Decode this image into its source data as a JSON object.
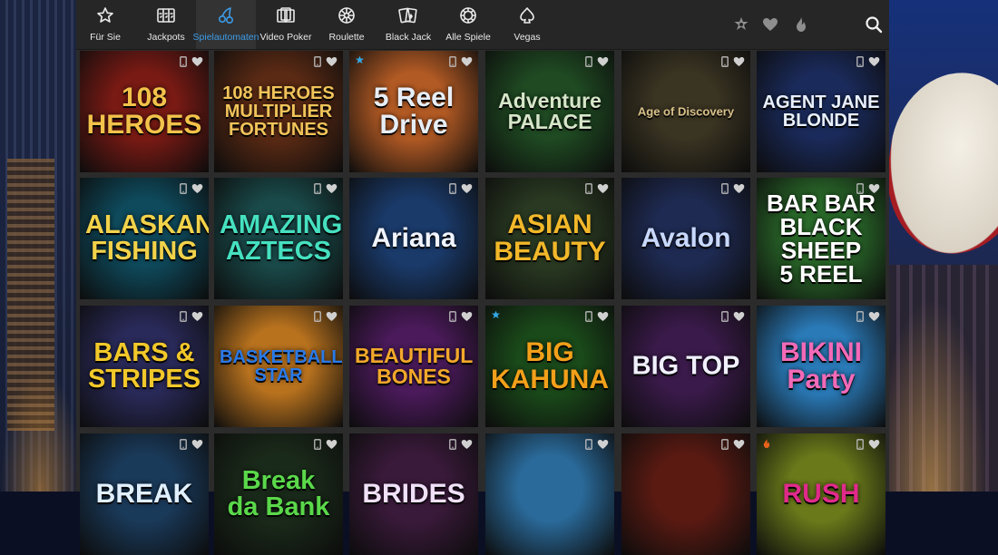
{
  "nav": {
    "items": [
      {
        "label": "Für Sie",
        "icon": "star-icon",
        "active": false
      },
      {
        "label": "Jackpots",
        "icon": "slot-reels-icon",
        "active": false
      },
      {
        "label": "Spielautomaten",
        "icon": "cherries-icon",
        "active": true
      },
      {
        "label": "Video Poker",
        "icon": "cards-icon",
        "active": false
      },
      {
        "label": "Roulette",
        "icon": "roulette-wheel-icon",
        "active": false
      },
      {
        "label": "Black Jack",
        "icon": "blackjack-cards-icon",
        "active": false
      },
      {
        "label": "Alle Spiele",
        "icon": "chip-icon",
        "active": false
      },
      {
        "label": "Vegas",
        "icon": "spade-icon",
        "active": false
      }
    ],
    "right_icons": [
      "sheriff-star-icon",
      "heart-icon",
      "flame-icon",
      "search-icon"
    ]
  },
  "games": [
    {
      "title": "108\nHEROES",
      "bg": "#7a1a14",
      "fg": "#f2c24a",
      "badge": ""
    },
    {
      "title": "108 HEROES\nMULTIPLIER\nFORTUNES",
      "bg": "#5a2a14",
      "fg": "#f1c45a",
      "badge": ""
    },
    {
      "title": "5 Reel\nDrive",
      "bg": "#b25a24",
      "fg": "#e8eef5",
      "badge": "star"
    },
    {
      "title": "Adventure\nPALACE",
      "bg": "#1f4a22",
      "fg": "#d6e6c8",
      "badge": ""
    },
    {
      "title": "Age of Discovery",
      "bg": "#3a3422",
      "fg": "#d8c08a",
      "badge": ""
    },
    {
      "title": "AGENT JANE\nBLONDE",
      "bg": "#1a2a5a",
      "fg": "#e8f0ff",
      "badge": ""
    },
    {
      "title": "ALASKAN\nFISHING",
      "bg": "#0e4a5c",
      "fg": "#f2d24a",
      "badge": ""
    },
    {
      "title": "AMAZING\nAZTECS",
      "bg": "#1a4a4a",
      "fg": "#45e0c0",
      "badge": ""
    },
    {
      "title": "Ariana",
      "bg": "#1a3a6a",
      "fg": "#f0f4ff",
      "badge": ""
    },
    {
      "title": "ASIAN\nBEAUTY",
      "bg": "#2a3a22",
      "fg": "#f2b82a",
      "badge": ""
    },
    {
      "title": "Avalon",
      "bg": "#1e2a52",
      "fg": "#c8d8ff",
      "badge": ""
    },
    {
      "title": "BAR BAR\nBLACK\nSHEEP\n5 REEL",
      "bg": "#2a6a2a",
      "fg": "#ffffff",
      "badge": ""
    },
    {
      "title": "BARS &\nSTRIPES",
      "bg": "#2a2a5a",
      "fg": "#f2c82a",
      "badge": ""
    },
    {
      "title": "BASKETBALL\nSTAR",
      "bg": "#b8721e",
      "fg": "#2a7ae8",
      "badge": ""
    },
    {
      "title": "BEAUTIFUL\nBONES",
      "bg": "#4a1a5a",
      "fg": "#f2a82a",
      "badge": ""
    },
    {
      "title": "BIG\nKAHUNA",
      "bg": "#1a4a1a",
      "fg": "#f2a01a",
      "badge": "star"
    },
    {
      "title": "BIG TOP",
      "bg": "#3a1a4a",
      "fg": "#f0f0ff",
      "badge": ""
    },
    {
      "title": "BIKINI\nParty",
      "bg": "#2a7ab8",
      "fg": "#f26ab8",
      "badge": ""
    },
    {
      "title": "BREAK",
      "bg": "#1a3a5a",
      "fg": "#e0f0ff",
      "badge": ""
    },
    {
      "title": "Break\nda Bank",
      "bg": "#1a2a1a",
      "fg": "#5ad84a",
      "badge": ""
    },
    {
      "title": "BRIDES",
      "bg": "#3a1a3a",
      "fg": "#f0e0f8",
      "badge": ""
    },
    {
      "title": "",
      "bg": "#2a6a9a",
      "fg": "#ffffff",
      "badge": ""
    },
    {
      "title": "",
      "bg": "#5a1a12",
      "fg": "#f27a1a",
      "badge": ""
    },
    {
      "title": "RUSH",
      "bg": "#6a7a1a",
      "fg": "#e02a8a",
      "badge": "flame"
    }
  ],
  "colors": {
    "nav_bg": "#262626",
    "panel_bg": "#2b2b2b",
    "active_accent": "#3c9be6",
    "badge_star": "#33aae8",
    "badge_flame": "#e8621a",
    "tile_icon": "#bdbdbd"
  }
}
